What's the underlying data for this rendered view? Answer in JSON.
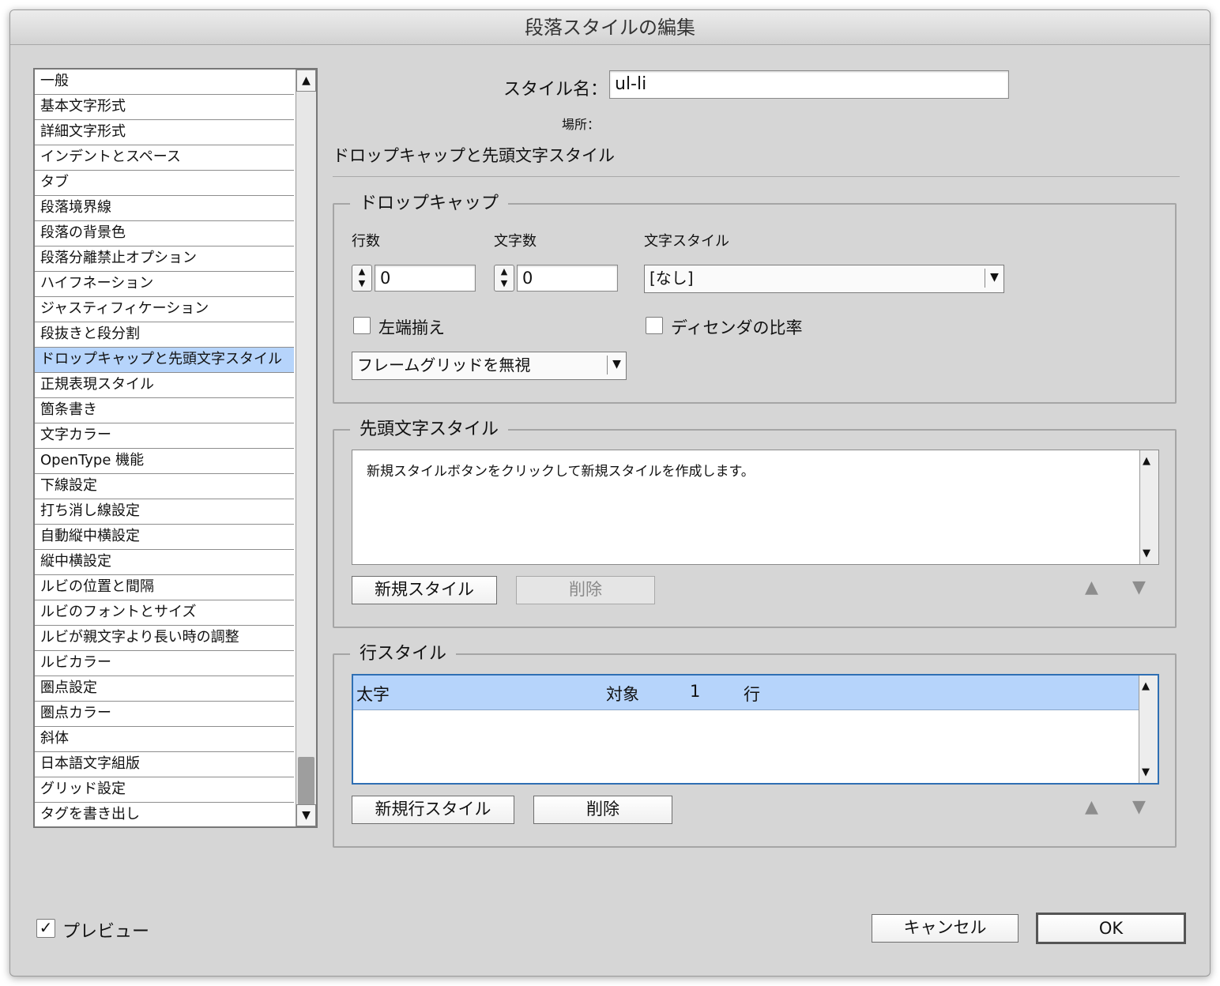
{
  "window": {
    "title": "段落スタイルの編集"
  },
  "categories": [
    "一般",
    "基本文字形式",
    "詳細文字形式",
    "インデントとスペース",
    "タブ",
    "段落境界線",
    "段落の背景色",
    "段落分離禁止オプション",
    "ハイフネーション",
    "ジャスティフィケーション",
    "段抜きと段分割",
    "ドロップキャップと先頭文字スタイル",
    "正規表現スタイル",
    "箇条書き",
    "文字カラー",
    "OpenType 機能",
    "下線設定",
    "打ち消し線設定",
    "自動縦中横設定",
    "縦中横設定",
    "ルビの位置と間隔",
    "ルビのフォントとサイズ",
    "ルビが親文字より長い時の調整",
    "ルビカラー",
    "圏点設定",
    "圏点カラー",
    "斜体",
    "日本語文字組版",
    "グリッド設定",
    "タグを書き出し"
  ],
  "selected_category": "ドロップキャップと先頭文字スタイル",
  "style_name": {
    "label": "スタイル名：",
    "value": "ul-li"
  },
  "location": {
    "label": "場所："
  },
  "section_title": "ドロップキャップと先頭文字スタイル",
  "drop_cap": {
    "title": "ドロップキャップ",
    "lines_label": "行数",
    "lines_value": "0",
    "chars_label": "文字数",
    "chars_value": "0",
    "char_style_label": "文字スタイル",
    "char_style_value": "[なし]",
    "align_left_label": "左端揃え",
    "align_left_checked": false,
    "descender_label": "ディセンダの比率",
    "descender_checked": false,
    "frame_grid_value": "フレームグリッドを無視"
  },
  "nested_styles": {
    "title": "先頭文字スタイル",
    "hint": "新規スタイルボタンをクリックして新規スタイルを作成します。",
    "new_button": "新規スタイル",
    "delete_button": "削除"
  },
  "line_styles": {
    "title": "行スタイル",
    "rows": [
      {
        "style": "太字",
        "target": "対象",
        "count": "1",
        "unit": "行"
      }
    ],
    "new_button": "新規行スタイル",
    "delete_button": "削除"
  },
  "footer": {
    "preview_label": "プレビュー",
    "preview_checked": true,
    "cancel_button": "キャンセル",
    "ok_button": "OK"
  },
  "icons": {
    "scroll_up": "▲",
    "scroll_down": "▼",
    "dropdown": "▼",
    "check": "✓",
    "move_up": "▲",
    "move_down": "▼"
  },
  "colors": {
    "selection": "#b6d4fb",
    "dialog_bg": "#d6d6d6",
    "focus_border": "#2f6fb3"
  }
}
